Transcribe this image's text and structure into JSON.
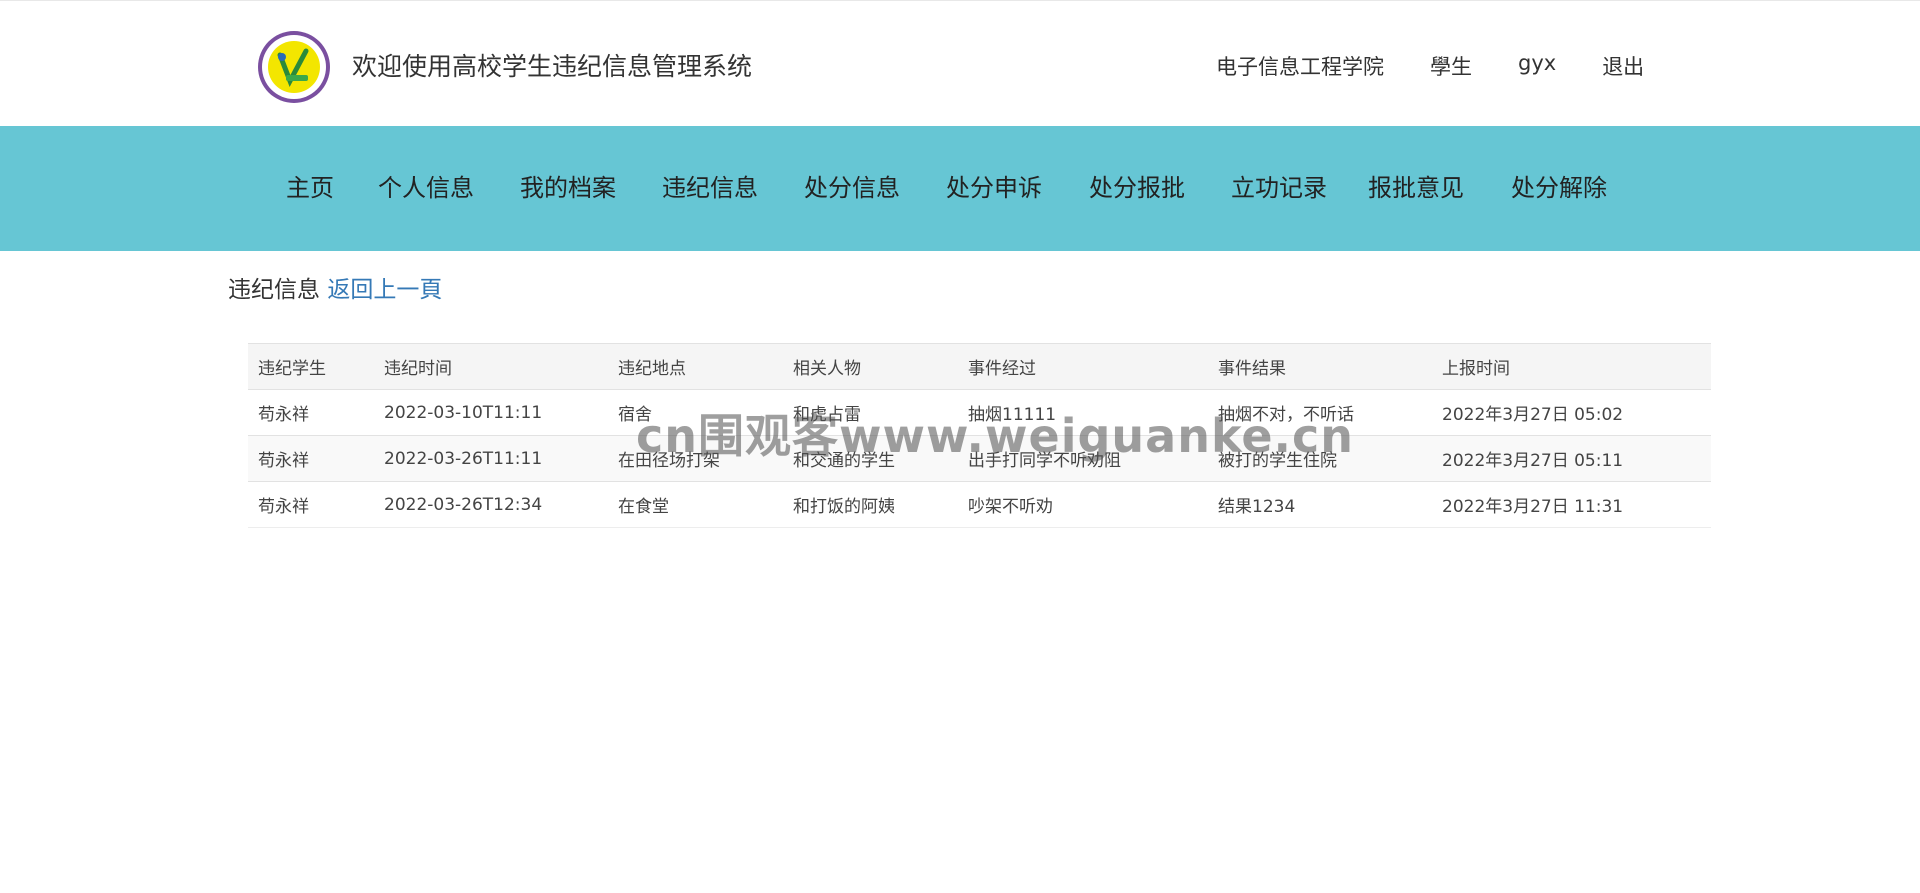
{
  "header": {
    "logo_icon": "school-seal-icon",
    "title": "欢迎使用高校学生违纪信息管理系统",
    "links": {
      "college": "电子信息工程学院",
      "role": "學生",
      "username": "gyx",
      "logout": "退出"
    }
  },
  "nav": {
    "items": [
      {
        "label": "主页"
      },
      {
        "label": "个人信息"
      },
      {
        "label": "我的档案"
      },
      {
        "label": "违纪信息"
      },
      {
        "label": "处分信息"
      },
      {
        "label": "处分申诉"
      },
      {
        "label": "处分报批"
      },
      {
        "label": "立功记录"
      },
      {
        "label": "报批意见"
      },
      {
        "label": "处分解除"
      }
    ]
  },
  "page": {
    "heading": "违纪信息",
    "back_link": "返回上一頁"
  },
  "table": {
    "columns": [
      "违纪学生",
      "违纪时间",
      "违纪地点",
      "相关人物",
      "事件经过",
      "事件结果",
      "上报时间"
    ],
    "rows": [
      [
        "苟永祥",
        "2022-03-10T11:11",
        "宿舍",
        "和虎占雷",
        "抽烟11111",
        "抽烟不对，不听话",
        "2022年3月27日 05:02"
      ],
      [
        "苟永祥",
        "2022-03-26T11:11",
        "在田径场打架",
        "和交通的学生",
        "出手打同学不听劝阻",
        "被打的学生住院",
        "2022年3月27日 05:11"
      ],
      [
        "苟永祥",
        "2022-03-26T12:34",
        "在食堂",
        "和打饭的阿姨",
        "吵架不听劝",
        "结果1234",
        "2022年3月27日 11:31"
      ]
    ]
  },
  "watermark": "cn围观客www.weiguanke.cn",
  "colors": {
    "nav_bg": "#66c6d4",
    "link": "#3579b6"
  }
}
